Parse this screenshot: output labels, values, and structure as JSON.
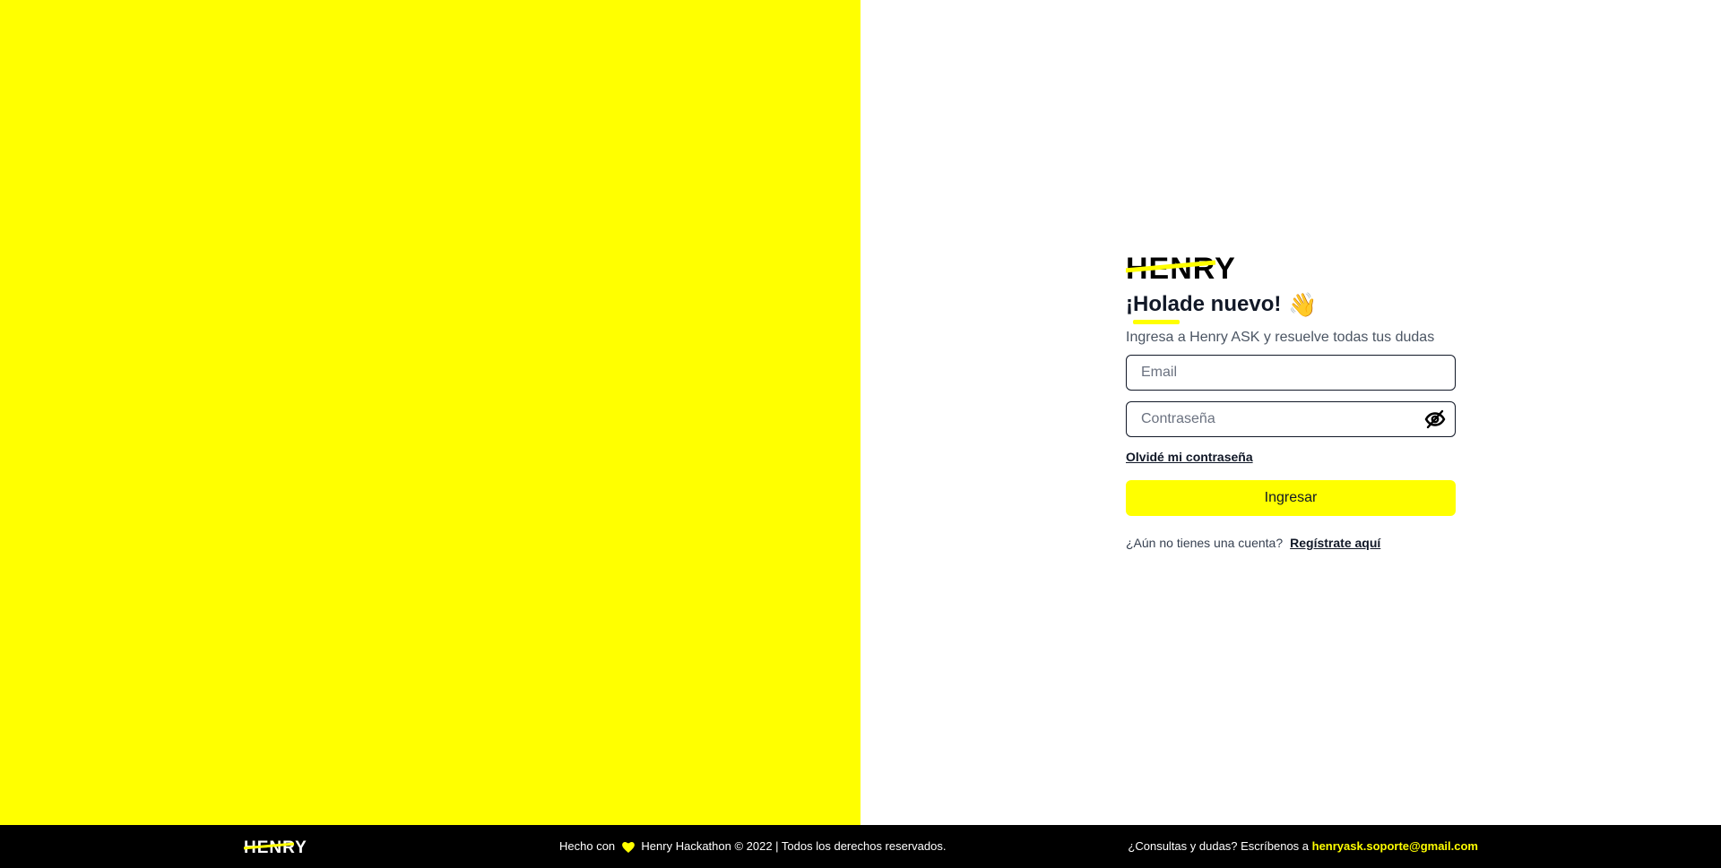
{
  "brand": {
    "logo_text": "HENRY",
    "accent_color": "#ffff00"
  },
  "login": {
    "greeting_hola": "¡Hola",
    "greeting_rest": " de nuevo!",
    "wave_emoji": "👋",
    "subtitle": "Ingresa a Henry ASK y resuelve todas tus dudas",
    "email_placeholder": "Email",
    "password_placeholder": "Contraseña",
    "toggle_password_icon": "eye-off-icon",
    "forgot_password": "Olvidé mi contraseña",
    "submit_label": "Ingresar",
    "no_account_text": "¿Aún no tienes una cuenta?",
    "register_link": "Regístrate aquí"
  },
  "footer": {
    "made_with": "Hecho con",
    "heart_icon": "heart-icon",
    "credits": "Henry Hackathon © 2022 | Todos los derechos reservados.",
    "contact_text": "¿Consultas y dudas? Escríbenos a",
    "contact_email": "henryask.soporte@gmail.com"
  }
}
